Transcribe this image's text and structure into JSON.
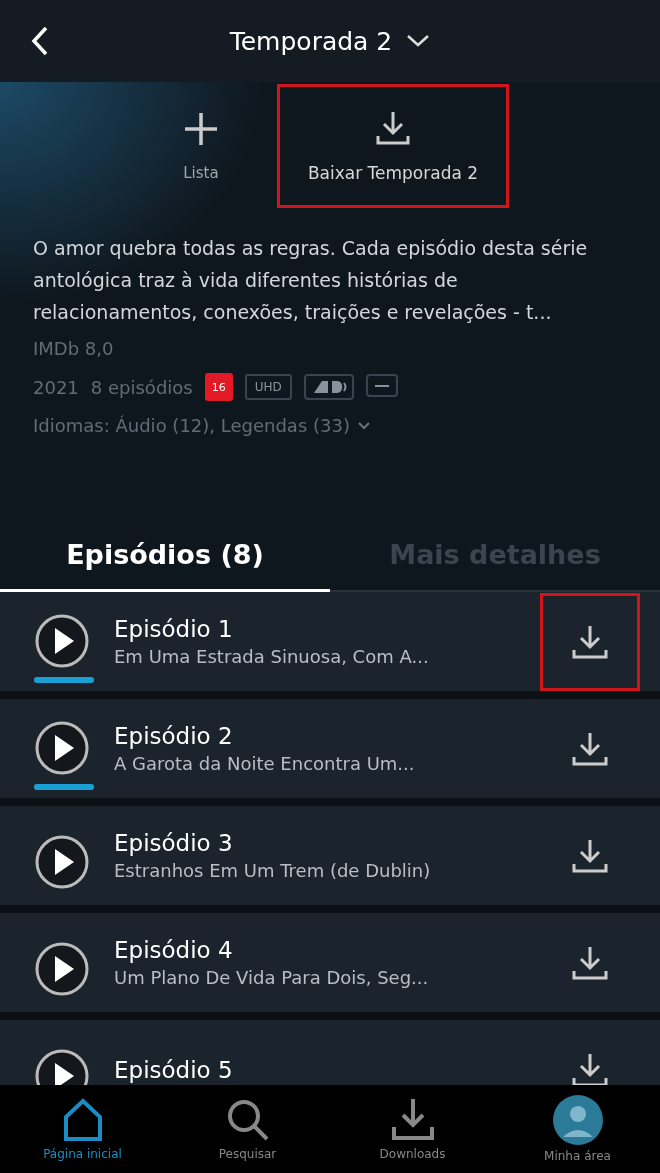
{
  "header": {
    "title": "Temporada 2"
  },
  "actions": [
    {
      "kind": "add",
      "label": "Lista",
      "highlighted": false
    },
    {
      "kind": "download",
      "label": "Baixar Temporada 2",
      "highlighted": true
    }
  ],
  "description": "O amor quebra todas as regras. Cada episódio desta série antológica traz à vida diferentes histórias de relacionamentos, conexões, traições e revelações - t...",
  "rating": "IMDb 8,0",
  "year": "2021",
  "episode_count": "8 episódios",
  "badges": [
    {
      "kind": "age",
      "label": "16"
    },
    {
      "kind": "text",
      "label": "UHD"
    },
    {
      "kind": "ad"
    },
    {
      "kind": "subtitles"
    }
  ],
  "languages": "Idiomas: Áudio (12), Legendas (33)",
  "tabs": [
    {
      "label": "Episódios (8)",
      "selected": true
    },
    {
      "label": "Mais detalhes",
      "selected": false
    }
  ],
  "episodes": [
    {
      "title": "Episódio 1",
      "subtitle": "Em Uma Estrada Sinuosa, Com A...",
      "level": 1,
      "highlighted": true
    },
    {
      "title": "Episódio 2",
      "subtitle": "A Garota da Noite Encontra Um...",
      "level": 1,
      "highlighted": false
    },
    {
      "title": "Episódio 3",
      "subtitle": "Estranhos Em Um Trem (de Dublin)",
      "highlighted": false
    },
    {
      "title": "Episódio 4",
      "subtitle": "Um Plano De Vida Para Dois, Seg...",
      "highlighted": false
    },
    {
      "title": "Episódio 5",
      "highlighted": false
    }
  ],
  "nav": [
    {
      "kind": "home",
      "label": "Página inicial",
      "selected": true
    },
    {
      "kind": "search",
      "label": "Pesquisar",
      "selected": false
    },
    {
      "kind": "download",
      "label": "Downloads",
      "selected": false
    },
    {
      "kind": "profile",
      "label": "Minha área",
      "selected": false
    }
  ]
}
